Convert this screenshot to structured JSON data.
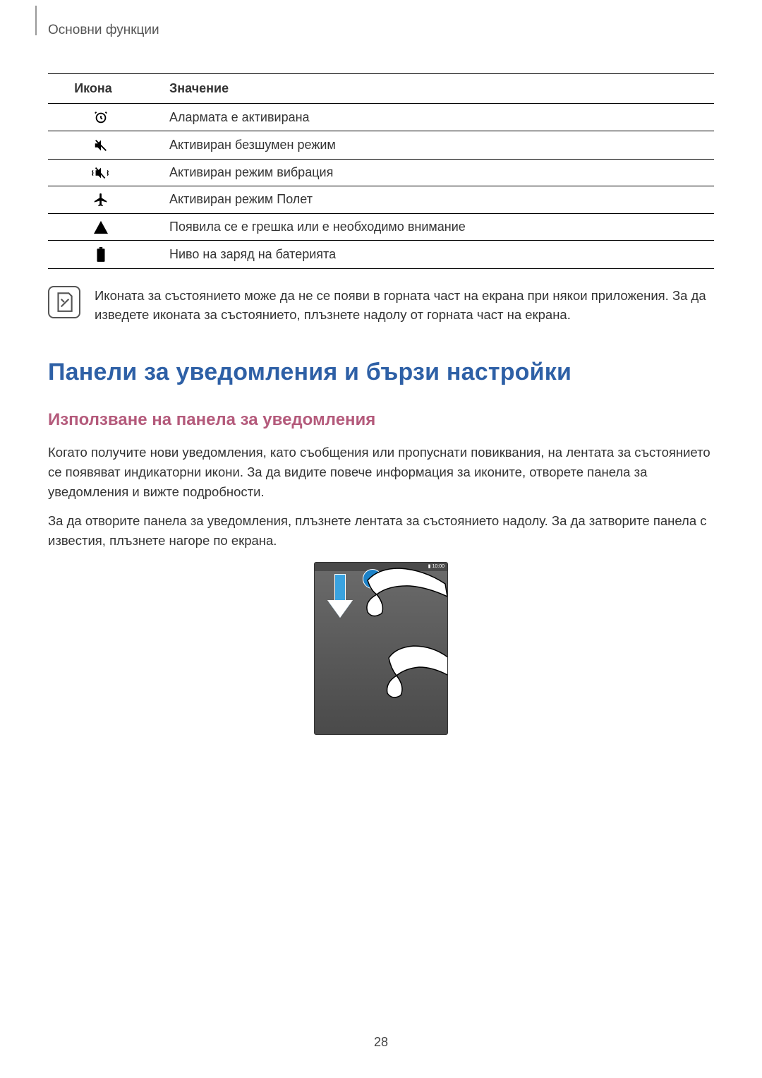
{
  "chapter": "Основни функции",
  "table": {
    "headers": {
      "icon": "Икона",
      "meaning": "Значение"
    },
    "rows": [
      {
        "icon": "alarm-icon",
        "meaning": "Алармата е активирана"
      },
      {
        "icon": "mute-icon",
        "meaning": "Активиран безшумен режим"
      },
      {
        "icon": "vibrate-icon",
        "meaning": "Активиран режим вибрация"
      },
      {
        "icon": "airplane-icon",
        "meaning": "Активиран режим Полет"
      },
      {
        "icon": "warning-icon",
        "meaning": "Появила се е грешка или е необходимо внимание"
      },
      {
        "icon": "battery-icon",
        "meaning": "Ниво на заряд на батерията"
      }
    ]
  },
  "note": "Иконата за състоянието може да не се появи в горната част на екрана при някои приложения. За да изведете иконата за състоянието, плъзнете надолу от горната част на екрана.",
  "section_title": "Панели за уведомления и бързи настройки",
  "subsection_title": "Използване на панела за уведомления",
  "paragraphs": [
    "Когато получите нови уведомления, като съобщения или пропуснати повиквания, на лентата за състоянието се появяват индикаторни икони. За да видите повече информация за иконите, отворете панела за уведомления и вижте подробности.",
    "За да отворите панела за уведомления, плъзнете лентата за състоянието надолу. За да затворите панела с известия, плъзнете нагоре по екрана."
  ],
  "illustration": {
    "status_text": "10:00",
    "description": "Swipe down gesture on device screen"
  },
  "page_number": "28"
}
